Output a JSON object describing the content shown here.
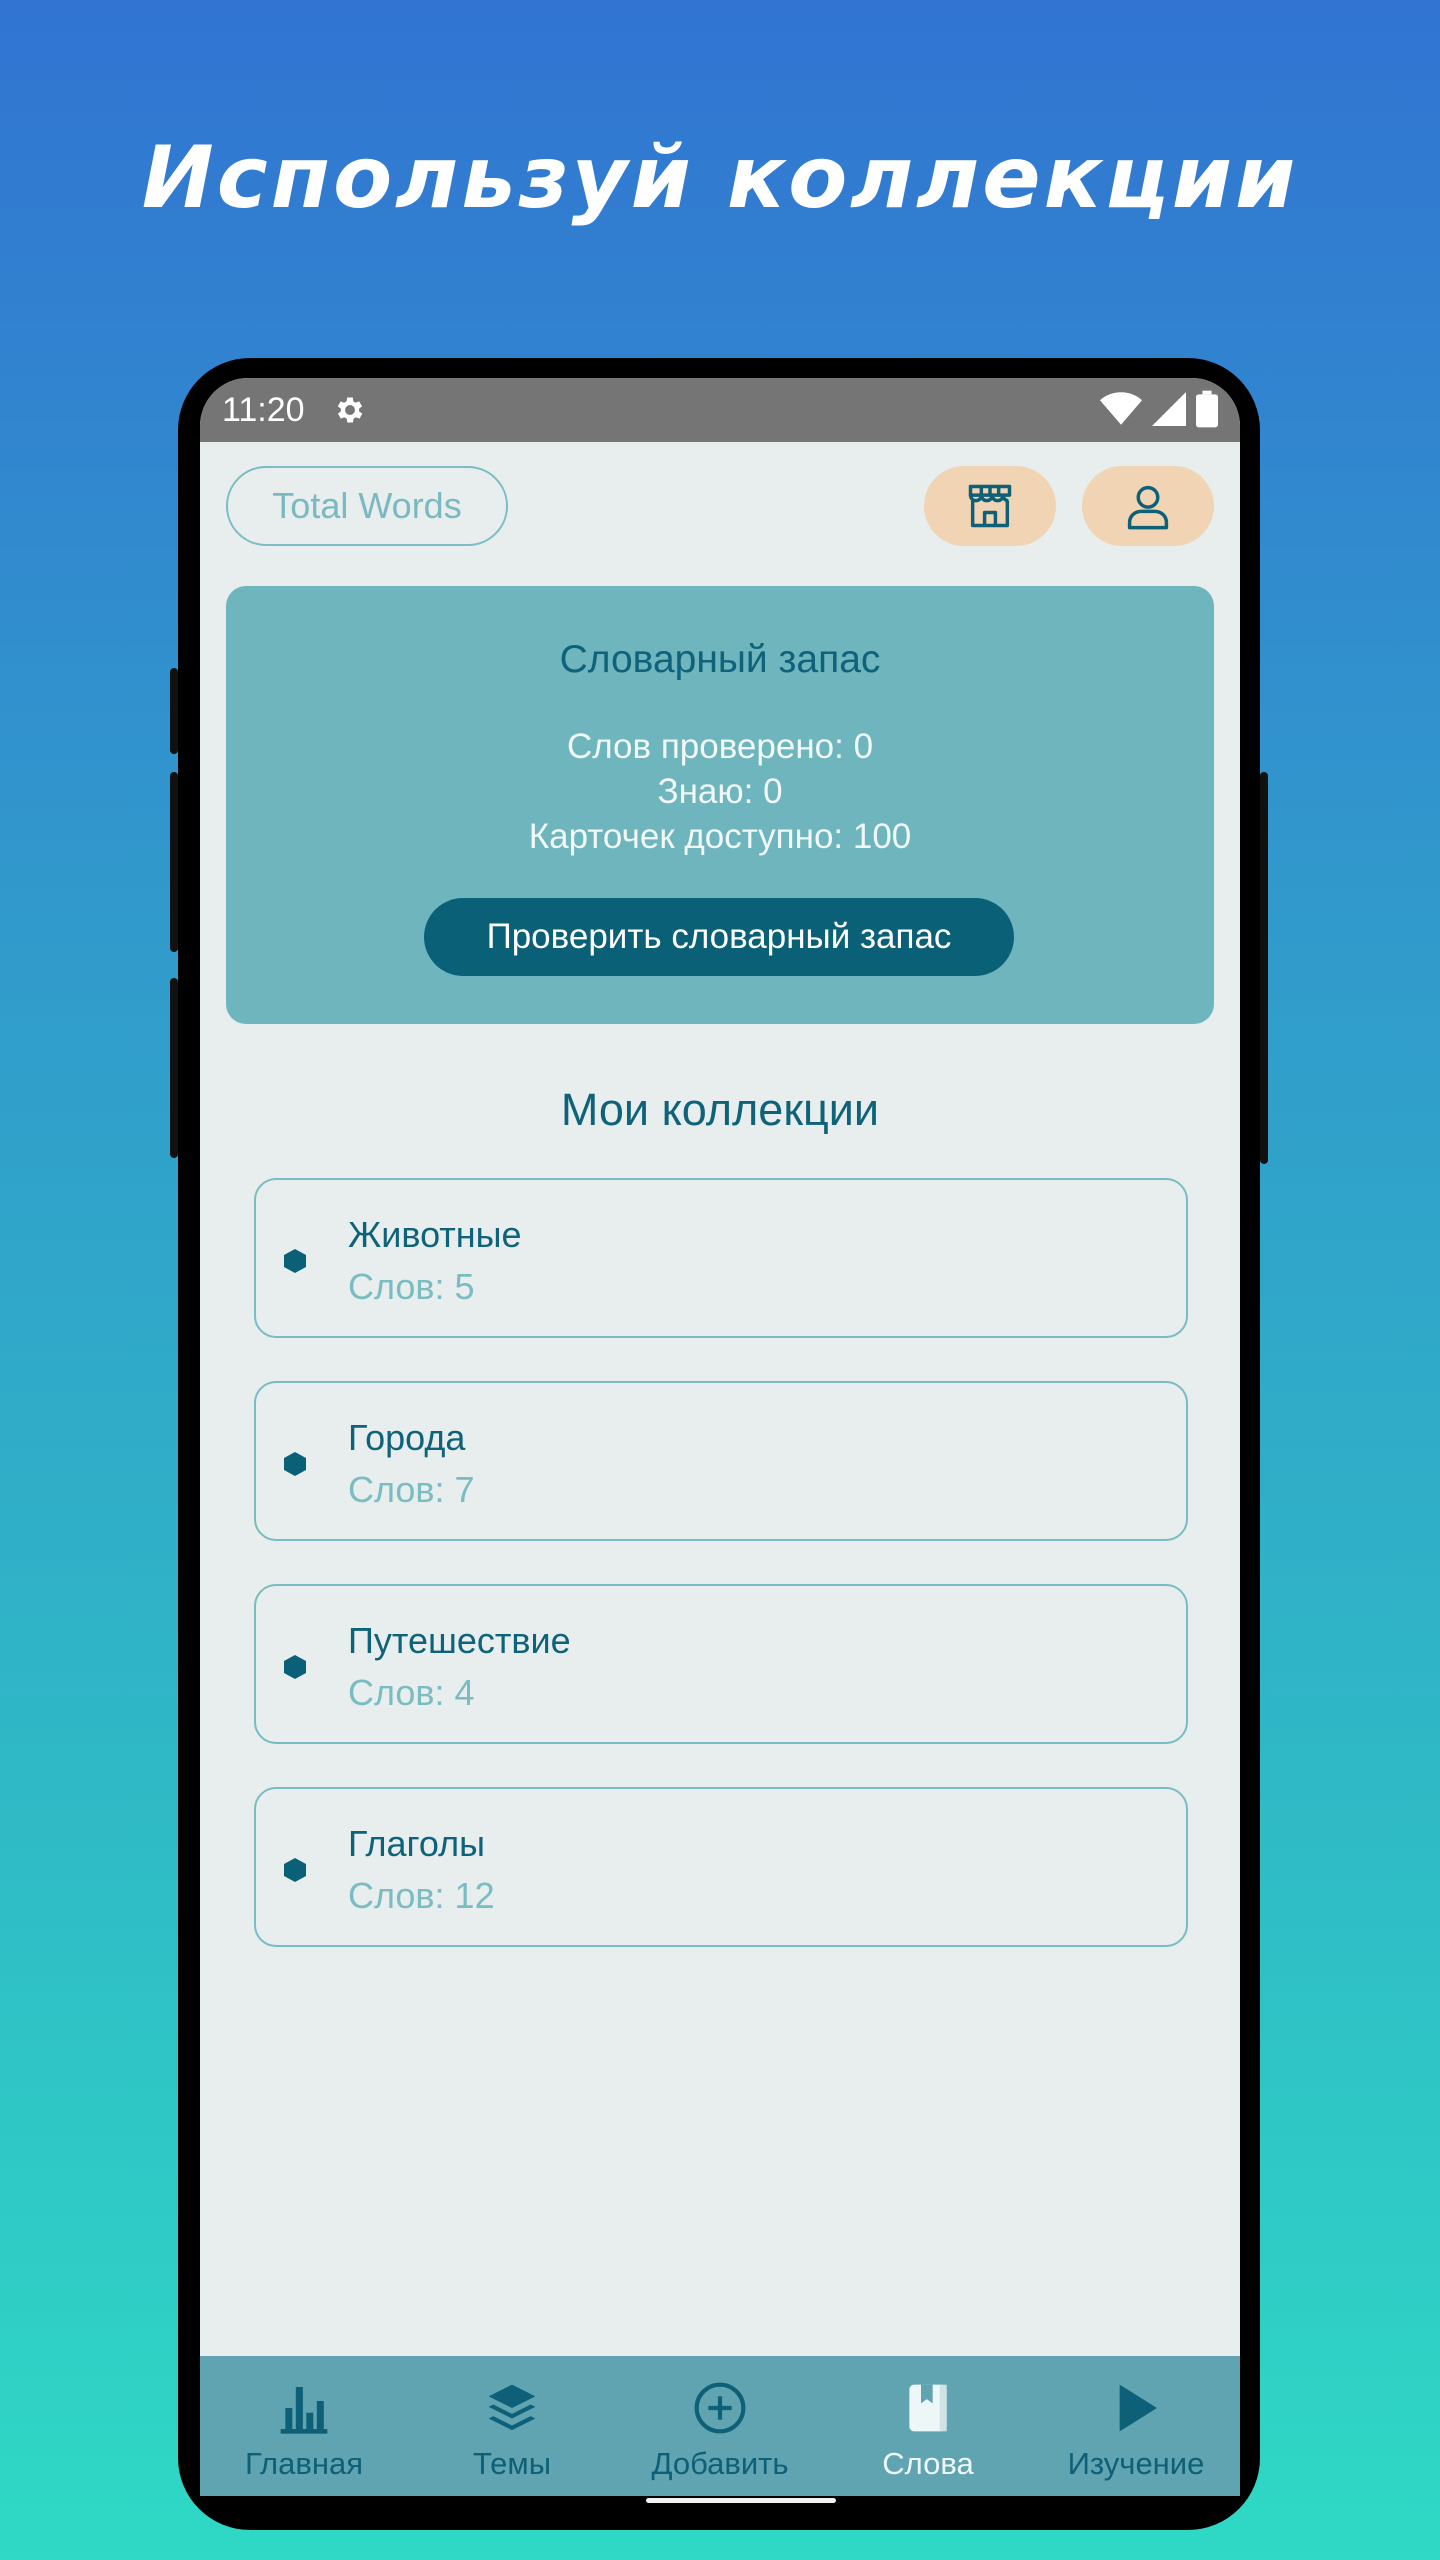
{
  "headline": "Используй коллекции",
  "status": {
    "time": "11:20"
  },
  "topbar": {
    "total_words": "Total Words",
    "shop_icon": "shop-icon",
    "profile_icon": "profile-icon"
  },
  "vocab": {
    "title": "Словарный запас",
    "checked": "Слов проверено: 0",
    "know": "Знаю: 0",
    "cards": "Карточек доступно: 100",
    "button": "Проверить словарный запас"
  },
  "collections": {
    "title": "Мои коллекции",
    "items": [
      {
        "name": "Животные",
        "count": "Слов: 5"
      },
      {
        "name": "Города",
        "count": "Слов: 7"
      },
      {
        "name": "Путешествие",
        "count": "Слов: 4"
      },
      {
        "name": "Глаголы",
        "count": "Слов: 12"
      }
    ]
  },
  "nav": {
    "items": [
      {
        "label": "Главная",
        "icon": "bar-chart-icon"
      },
      {
        "label": "Темы",
        "icon": "layers-icon"
      },
      {
        "label": "Добавить",
        "icon": "plus-circle-icon"
      },
      {
        "label": "Слова",
        "icon": "book-icon",
        "active": true
      },
      {
        "label": "Изучение",
        "icon": "play-icon"
      }
    ]
  },
  "colors": {
    "accent": "#0a6177",
    "card": "#6eb5bd",
    "nav": "#5fa4b0",
    "button_peach": "#f0d4b3"
  }
}
